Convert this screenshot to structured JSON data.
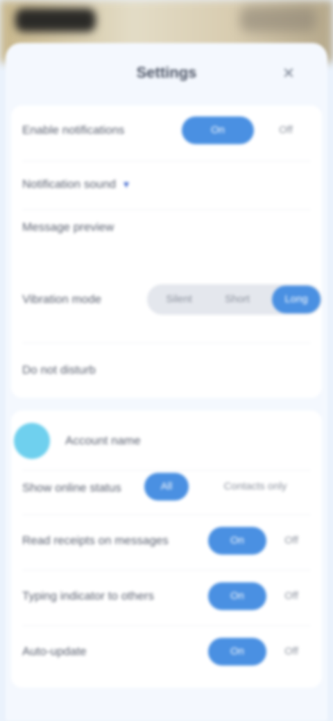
{
  "header": {
    "title": "Settings",
    "close_symbol": "✕"
  },
  "section1": {
    "row1_label": "Enable notifications",
    "row1_on": "On",
    "row1_off": "Off",
    "row2_label": "Notification sound",
    "row2_chevron": "▾",
    "row3_label": "Message preview"
  },
  "section2": {
    "row1_label": "Vibration mode",
    "row1_option_a": "Silent",
    "row1_option_b": "Short",
    "row1_option_c": "Long",
    "row2_label": "Do not disturb"
  },
  "section3": {
    "account_name": "Account name",
    "row1_label": "Show online status",
    "row1_option_a": "All",
    "row1_option_b": "Contacts only",
    "row2_label": "Read receipts on messages",
    "row2_on": "On",
    "row2_off": "Off",
    "row3_label": "Typing indicator to others",
    "row3_on": "On",
    "row3_off": "Off",
    "row4_label": "Auto-update",
    "row4_on": "On",
    "row4_off": "Off"
  },
  "colors": {
    "accent": "#4a90e2",
    "avatar": "#6fd0ee",
    "background": "#eaf2fc"
  }
}
